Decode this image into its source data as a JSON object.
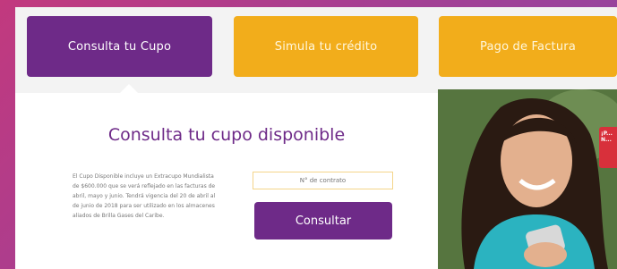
{
  "tabs": [
    {
      "label": "Consulta tu Cupo",
      "active": true
    },
    {
      "label": "Simula tu crédito",
      "active": false
    },
    {
      "label": "Pago de Factura",
      "active": false
    }
  ],
  "panel": {
    "title": "Consulta tu cupo disponible",
    "description": "El Cupo Disponible incluye un Extracupo Mundialista de $600.000 que se verá reflejado en las facturas de abril, mayo y junio. Tendrá vigencia del 20 de abril al de junio de 2018 para ser utilizado en los almacenes aliados de Brilla Gases del Caribe.",
    "input_placeholder": "N° de contrato",
    "button_label": "Consultar"
  },
  "promo": {
    "ribbon_text": "¡P... N..."
  },
  "colors": {
    "primary_purple": "#6e2a88",
    "accent_yellow": "#f2ad1b",
    "ribbon_red": "#d8303b"
  }
}
